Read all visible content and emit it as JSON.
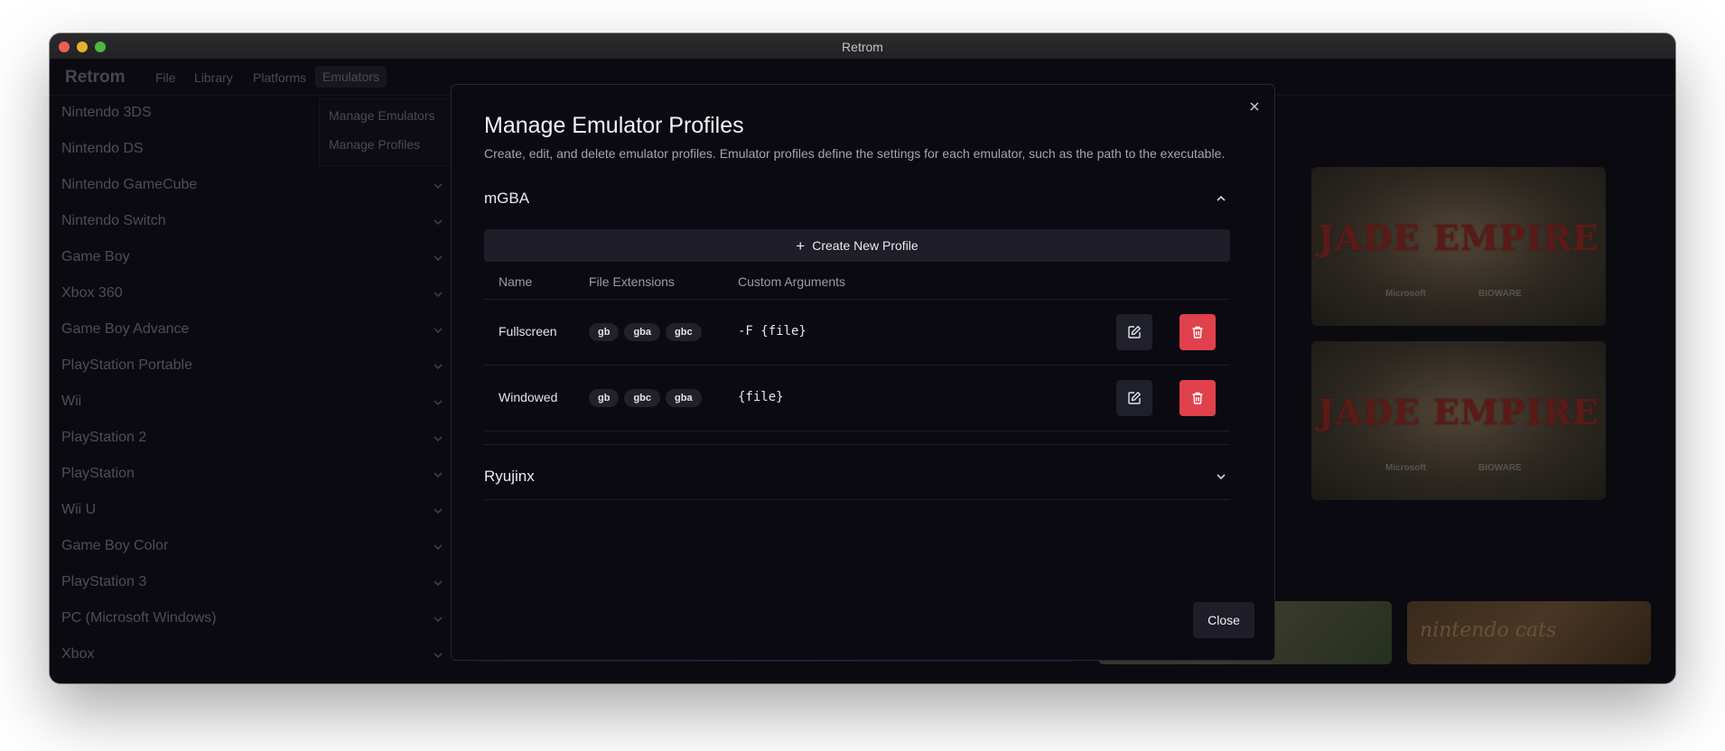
{
  "window": {
    "title": "Retrom"
  },
  "menubar": {
    "brand": "Retrom",
    "items": [
      "File",
      "Library",
      "Platforms",
      "Emulators"
    ]
  },
  "submenu": {
    "items": [
      "Manage Emulators",
      "Manage Profiles"
    ]
  },
  "sidebar": {
    "items": [
      "Nintendo 3DS",
      "Nintendo DS",
      "Nintendo GameCube",
      "Nintendo Switch",
      "Game Boy",
      "Xbox 360",
      "Game Boy Advance",
      "PlayStation Portable",
      "Wii",
      "PlayStation 2",
      "PlayStation",
      "Wii U",
      "Game Boy Color",
      "PlayStation 3",
      "PC (Microsoft Windows)",
      "Xbox"
    ]
  },
  "background_tiles": {
    "jade_title": "JADE EMPIRE",
    "publisher_left": "Microsoft",
    "publisher_right": "BIOWARE",
    "bottom_right": "nintendo cats"
  },
  "modal": {
    "title": "Manage Emulator Profiles",
    "description": "Create, edit, and delete emulator profiles. Emulator profiles define the settings for each emulator, such as the path to the executable.",
    "close_label": "Close",
    "create_label": "Create New Profile",
    "columns": [
      "Name",
      "File Extensions",
      "Custom Arguments"
    ],
    "emulators": [
      {
        "name": "mGBA",
        "expanded": true,
        "profiles": [
          {
            "name": "Fullscreen",
            "extensions": [
              "gb",
              "gba",
              "gbc"
            ],
            "args": "-F {file}"
          },
          {
            "name": "Windowed",
            "extensions": [
              "gb",
              "gbc",
              "gba"
            ],
            "args": "{file}"
          }
        ]
      },
      {
        "name": "Ryujinx",
        "expanded": false
      }
    ]
  },
  "colors": {
    "danger": "#e0414c",
    "surface": "#1e1d28",
    "background": "#0b0a12"
  }
}
